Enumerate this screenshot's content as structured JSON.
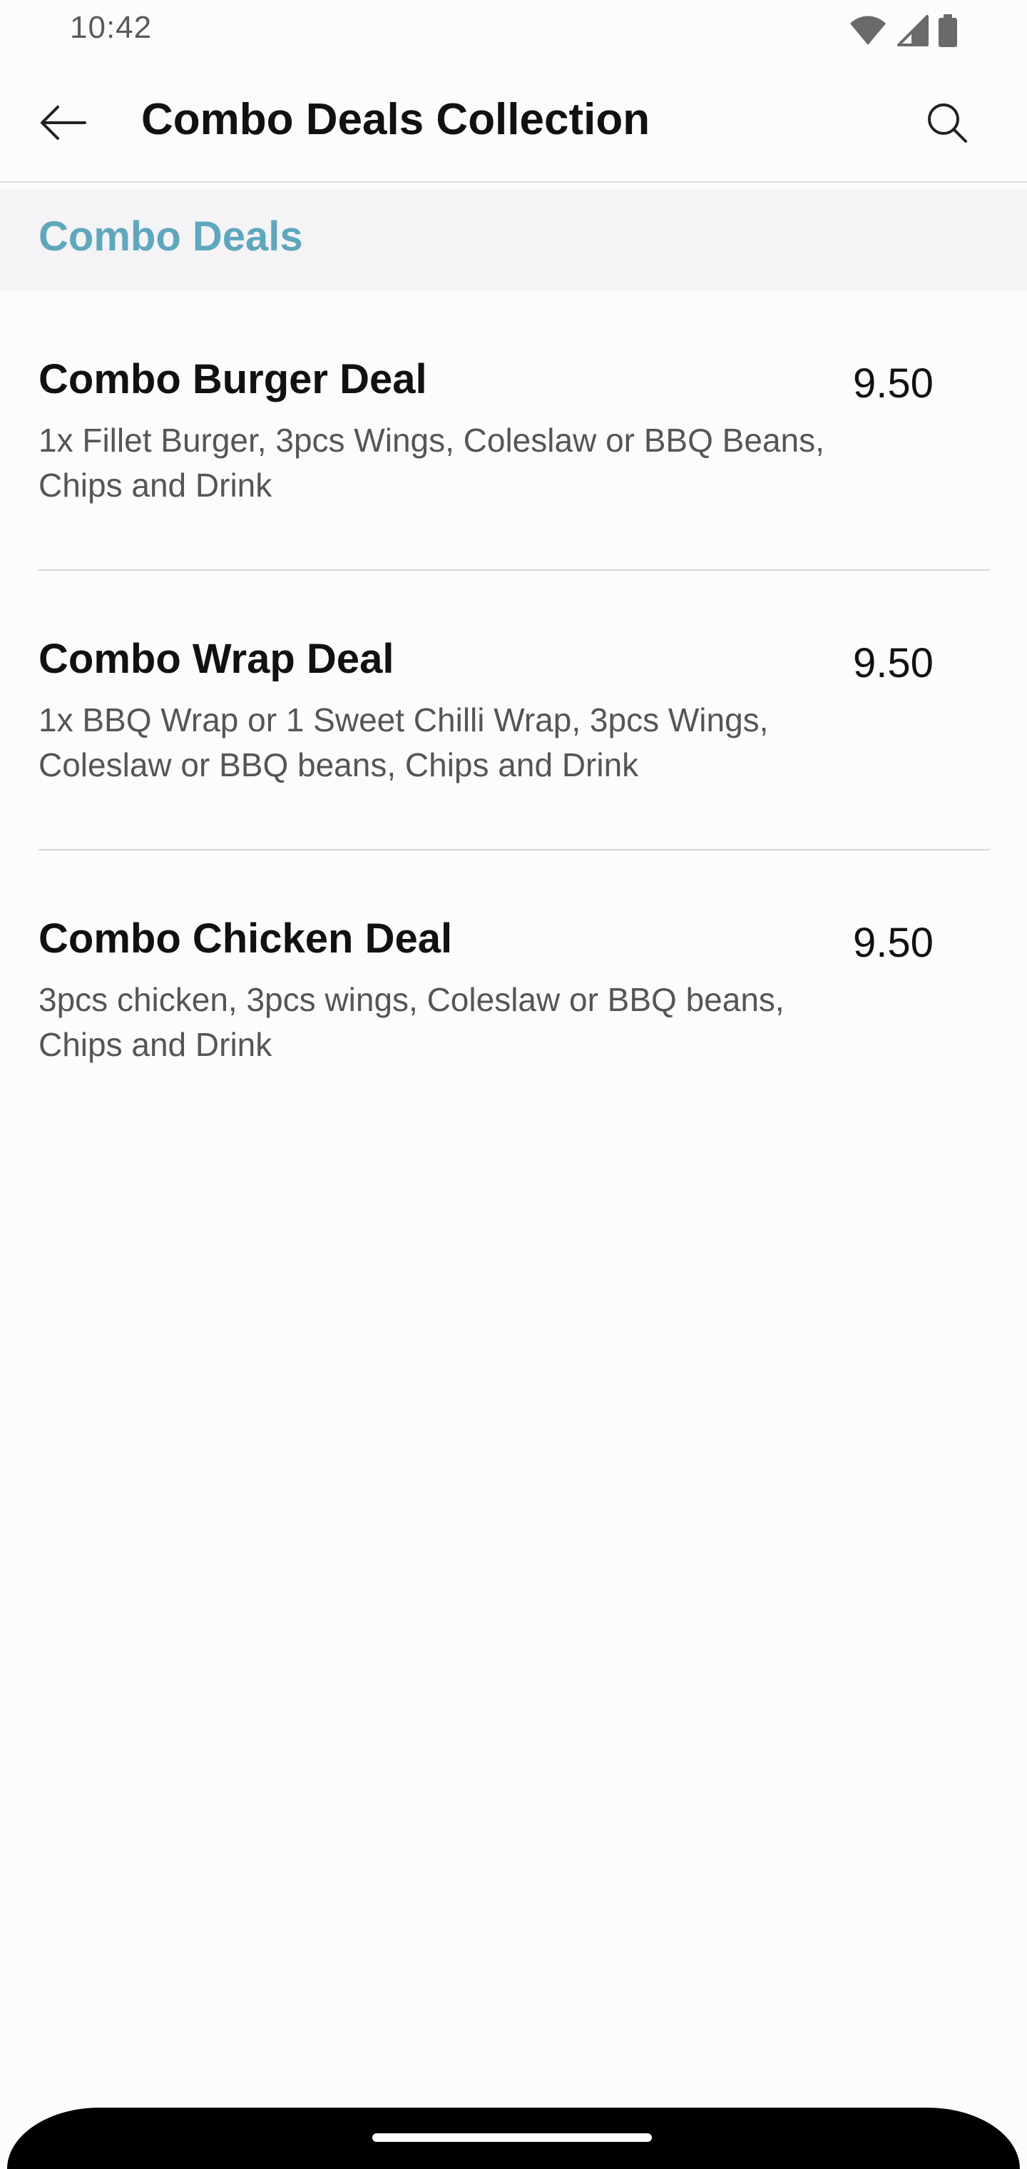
{
  "status_bar": {
    "time": "10:42",
    "icons": [
      "wifi-icon",
      "cellular-signal-icon",
      "battery-icon"
    ]
  },
  "app_bar": {
    "title": "Combo Deals Collection",
    "back_icon": "arrow-left-icon",
    "search_icon": "search-icon"
  },
  "section": {
    "title": "Combo Deals"
  },
  "menu": {
    "items": [
      {
        "name": "Combo Burger Deal",
        "price": "9.50",
        "description": "1x Fillet Burger, 3pcs Wings, Coleslaw or BBQ Beans, Chips and Drink"
      },
      {
        "name": "Combo Wrap Deal",
        "price": "9.50",
        "description": "1x BBQ Wrap or 1 Sweet Chilli Wrap, 3pcs Wings, Coleslaw or BBQ beans, Chips and Drink"
      },
      {
        "name": "Combo Chicken Deal",
        "price": "9.50",
        "description": "3pcs chicken, 3pcs wings, Coleslaw or BBQ beans, Chips and Drink"
      }
    ]
  },
  "colors": {
    "accent": "#5ea7bc",
    "section_background": "#f4f3f6",
    "text_primary": "#111111",
    "text_secondary": "#555555",
    "divider": "#d6d6d6"
  }
}
